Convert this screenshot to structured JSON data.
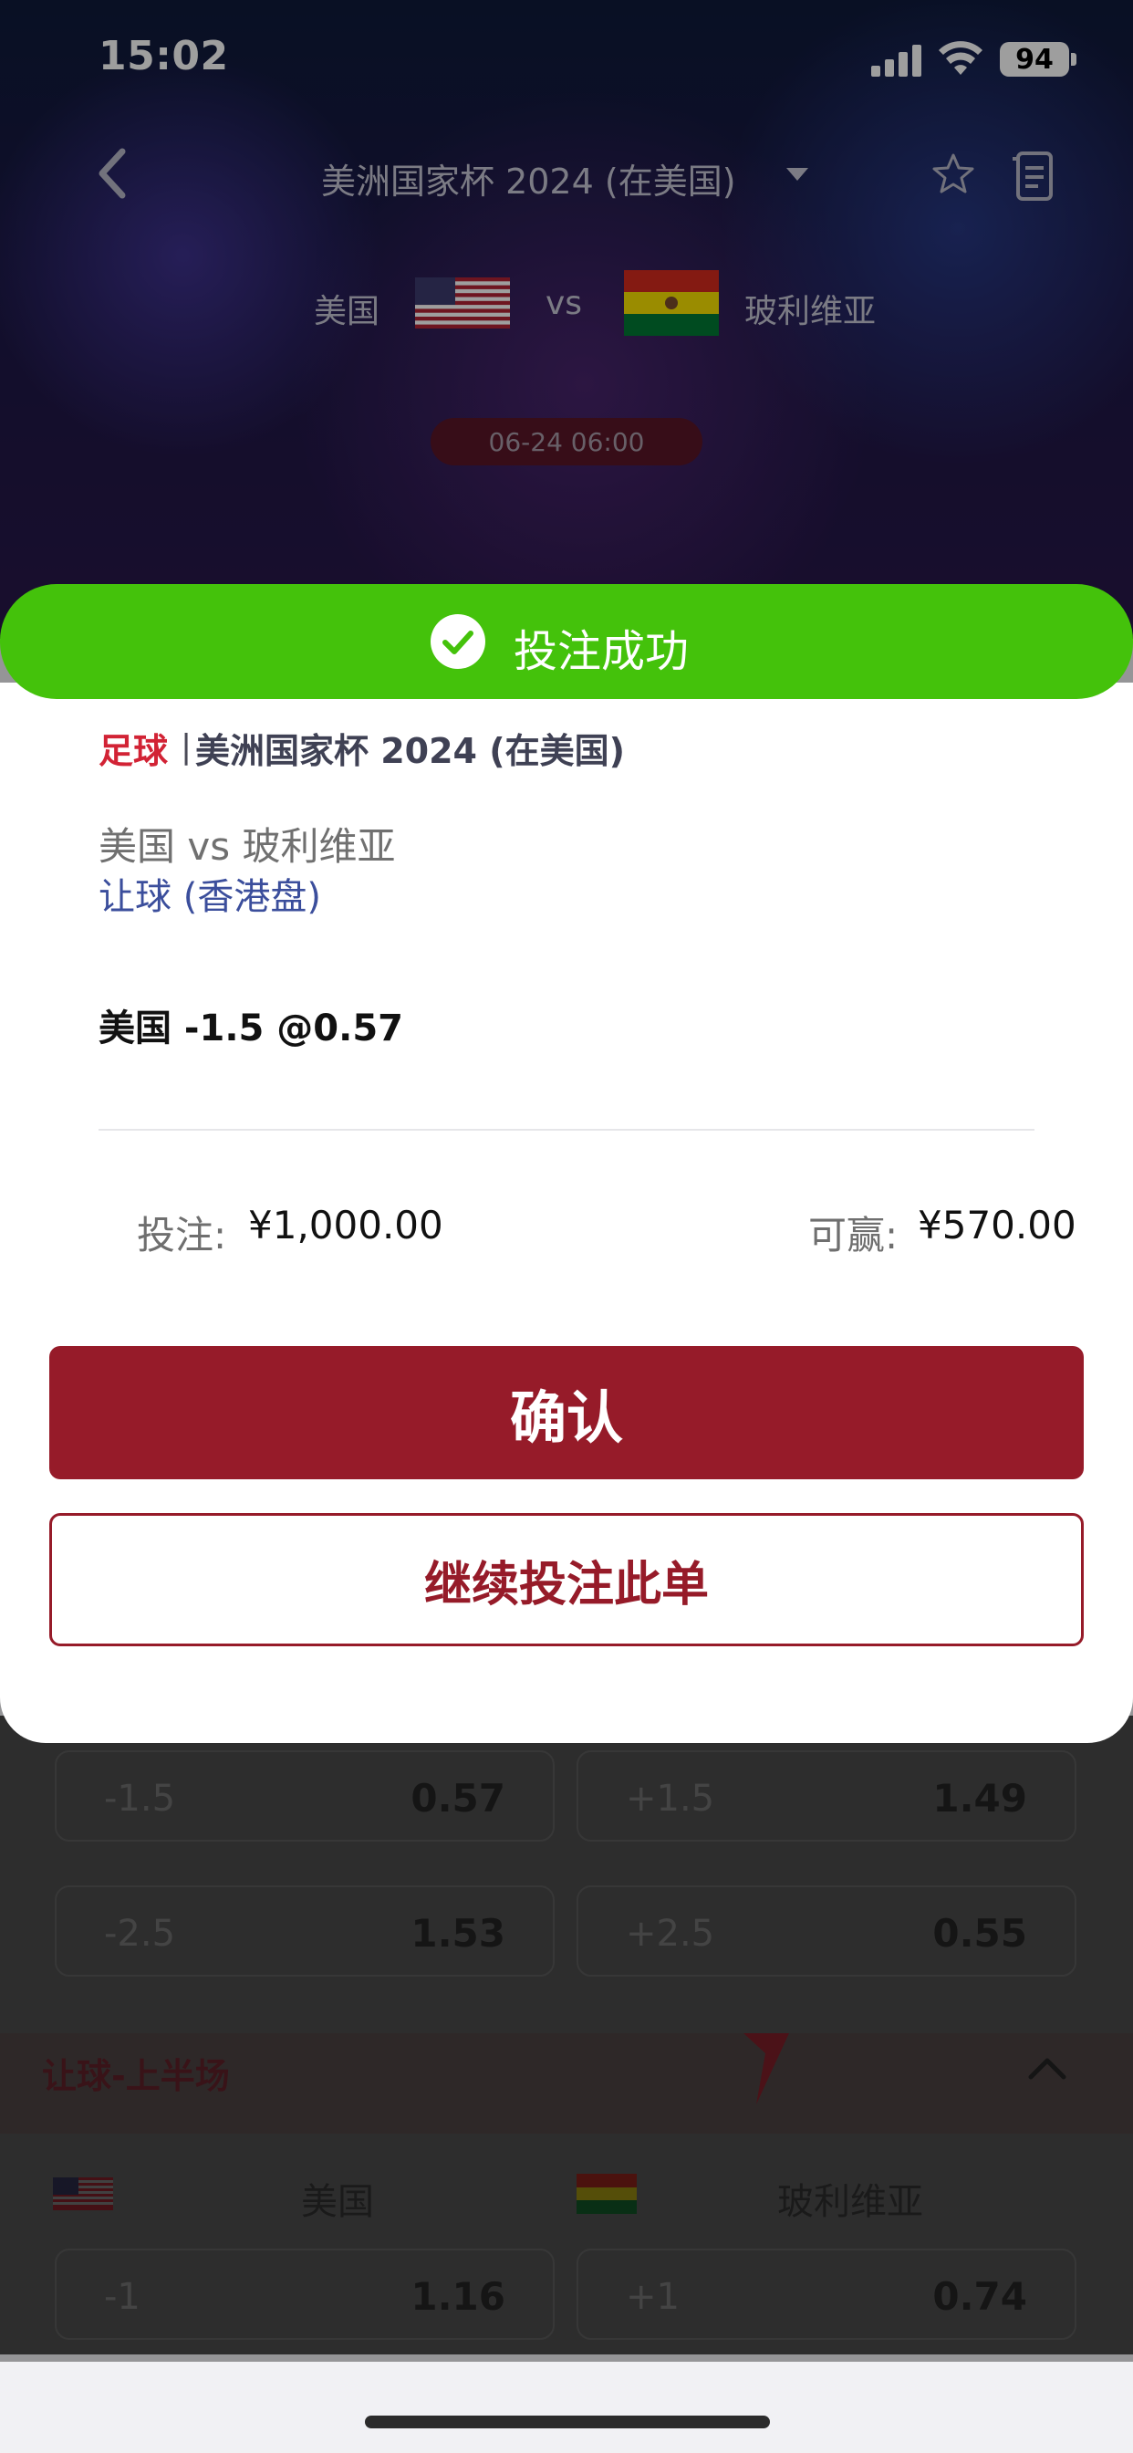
{
  "status_bar": {
    "time": "15:02",
    "battery": "94"
  },
  "header": {
    "title": "美洲国家杯 2024 (在美国)",
    "home_team": "美国",
    "vs": "vs",
    "away_team": "玻利维亚",
    "datetime": "06-24 06:00"
  },
  "background_markets": {
    "handicap_rows": [
      {
        "home_line": "-1.5",
        "home_odds": "0.57",
        "away_line": "+1.5",
        "away_odds": "1.49"
      },
      {
        "home_line": "-2.5",
        "home_odds": "1.53",
        "away_line": "+2.5",
        "away_odds": "0.55"
      }
    ],
    "first_half_section": {
      "title": "让球-上半场",
      "home_team": "美国",
      "away_team": "玻利维亚",
      "row": {
        "home_line": "-1",
        "home_odds": "1.16",
        "away_line": "+1",
        "away_odds": "0.74"
      }
    }
  },
  "bet_success": {
    "banner": "投注成功",
    "sport": "足球",
    "separator": "|",
    "league": "美洲国家杯 2024 (在美国)",
    "matchup": "美国 vs 玻利维亚",
    "market": "让球 (香港盘)",
    "selection": "美国 -1.5 @0.57",
    "stake_label": "投注:",
    "stake_value": "¥1,000.00",
    "win_label": "可赢:",
    "win_value": "¥570.00",
    "confirm_label": "确认",
    "continue_label": "继续投注此单"
  },
  "colors": {
    "success_green": "#44c20b",
    "brand_red": "#961b29",
    "sport_red": "#d22335",
    "market_blue": "#3b4e9c"
  }
}
